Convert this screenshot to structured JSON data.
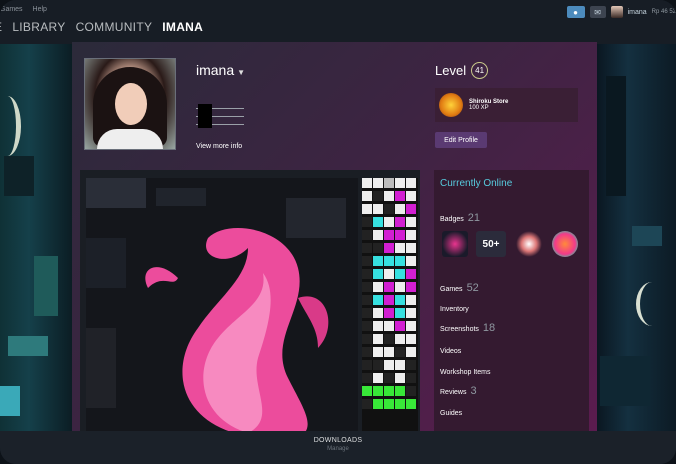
{
  "menu": {
    "small": [
      "Games",
      "Help"
    ],
    "tabs": [
      "E",
      "LIBRARY",
      "COMMUNITY",
      "IMANA"
    ],
    "active_tab": "IMANA",
    "account_name": "imana",
    "wallet": "Rp 46 52"
  },
  "profile": {
    "name": "imana",
    "view_more": "View more info",
    "level_label": "Level",
    "level": "41",
    "featured_badge": {
      "name": "Shiroku Store",
      "xp": "100 XP"
    },
    "edit_button": "Edit Profile"
  },
  "sidebar": {
    "status": "Currently Online",
    "badges": {
      "label": "Badges",
      "count": "21"
    },
    "badge_icons": [
      "badge-portrait-icon",
      "badge-50plus-icon",
      "badge-character-icon",
      "badge-face-icon"
    ],
    "badge_text": "50+",
    "games": {
      "label": "Games",
      "count": "52"
    },
    "inventory": "Inventory",
    "screenshots": {
      "label": "Screenshots",
      "count": "18"
    },
    "videos": "Videos",
    "workshop": "Workshop Items",
    "reviews": {
      "label": "Reviews",
      "count": "3"
    },
    "guides": "Guides"
  },
  "bottom": {
    "downloads": "DOWNLOADS",
    "manage": "Manage"
  },
  "colors": {
    "accent": "#57cbde",
    "profile_bg": "#5b1c4f",
    "edit_button": "#5a3a72"
  }
}
